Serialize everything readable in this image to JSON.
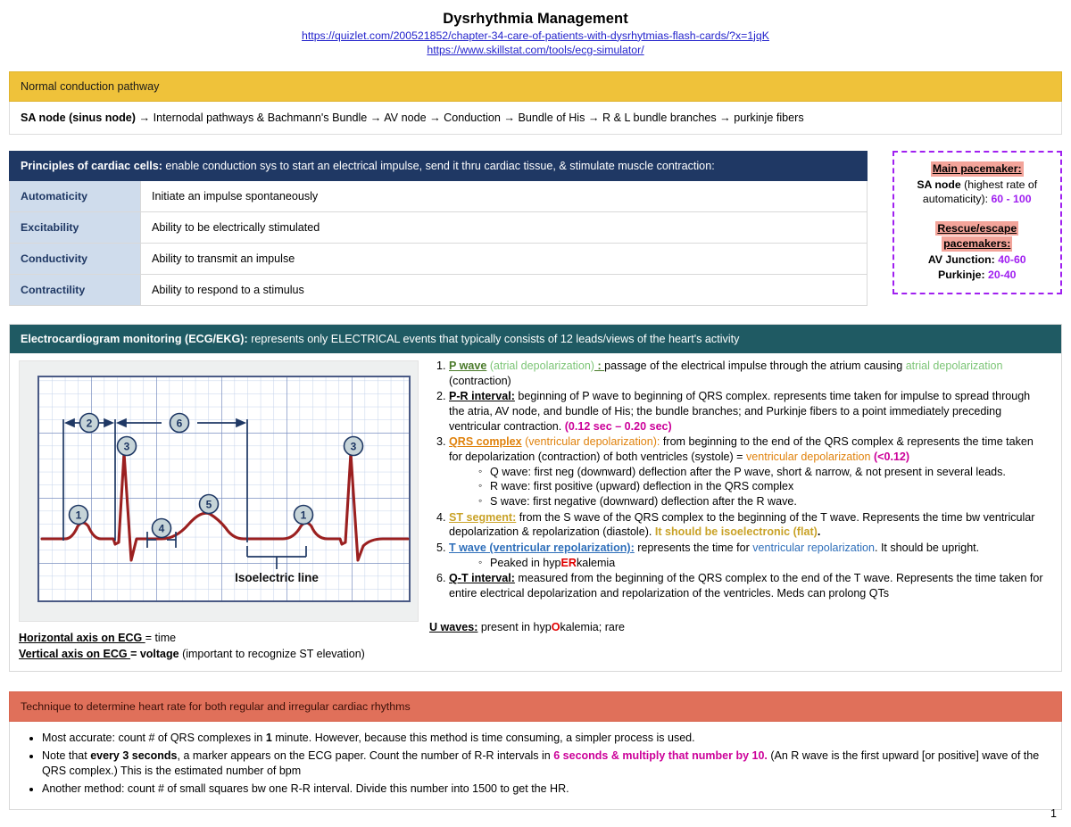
{
  "document": {
    "title": "Dysrhythmia Management",
    "links": [
      "https://quizlet.com/200521852/chapter-34-care-of-patients-with-dysrhytmias-flash-cards/?x=1jqK",
      "https://www.skillstat.com/tools/ecg-simulator/"
    ],
    "page_number": "1"
  },
  "conduction": {
    "header": "Normal conduction pathway",
    "pathway_start": "SA node (sinus node)",
    "pathway_rest": " → Internodal pathways & Bachmann's Bundle → AV node → Conduction → Bundle of His → R & L bundle branches → purkinje fibers"
  },
  "principles": {
    "header_bold": "Principles of cardiac cells:",
    "header_rest": " enable conduction sys to start an electrical impulse, send it thru cardiac tissue, & stimulate muscle contraction:",
    "rows": [
      {
        "term": "Automaticity",
        "definition": "Initiate an impulse spontaneously"
      },
      {
        "term": "Excitability",
        "definition": "Ability to be electrically stimulated"
      },
      {
        "term": "Conductivity",
        "definition": "Ability to transmit an impulse"
      },
      {
        "term": "Contractility",
        "definition": "Ability to respond to a stimulus"
      }
    ]
  },
  "pacemakers": {
    "main_heading": "Main pacemaker:",
    "main_bold": "SA node",
    "main_text": " (highest rate of automaticity): ",
    "main_rate": "60 - 100",
    "rescue_heading_line1": "Rescue/escape",
    "rescue_heading_line2": "pacemakers:",
    "rescue": [
      {
        "label": "AV Junction:",
        "rate": "40-60"
      },
      {
        "label": "Purkinje:",
        "rate": "20-40"
      }
    ]
  },
  "ecg": {
    "header_bold": "Electrocardiogram monitoring (ECG/EKG):",
    "header_rest": " represents only ELECTRICAL events that typically consists of 12 leads/views of the heart's activity",
    "figure": {
      "isoelectric_label": "Isoelectric line",
      "callouts": [
        "1",
        "2",
        "3",
        "4",
        "5",
        "6",
        "1",
        "3"
      ]
    },
    "axes": {
      "horizontal_label": "Horizontal axis on ECG ",
      "horizontal_value": "= time",
      "vertical_label": "Vertical axis on ECG ",
      "vertical_value_bold": "= voltage",
      "vertical_value_rest": " (important to recognize ST elevation)"
    },
    "items": {
      "i1": {
        "term": "P wave",
        "paren": " (atrial depolarization)",
        "colon": " : ",
        "text1": "passage of the electrical impulse through the atrium causing ",
        "hl": "atrial depolarization",
        "text2": " (contraction)"
      },
      "i2": {
        "term": "P-R interval:",
        "text": " beginning of P wave to beginning of QRS complex. represents time taken for impulse to spread through the atria, AV node, and bundle of His; the bundle branches; and Purkinje fibers to a point immediately preceding ventricular contraction. ",
        "value": "(0.12 sec – 0.20 sec)"
      },
      "i3": {
        "term": "QRS complex",
        "paren": " (ventricular depolarization):",
        "text1": " from beginning to the end of the QRS complex & represents the time taken for depolarization (contraction) of both ventricles (systole) = ",
        "hl": "ventricular depolarization",
        "value": " (<0.12)",
        "subs": [
          "Q wave: first neg (downward) deflection after the P wave, short & narrow, & not present in several leads.",
          "R wave: first positive (upward) deflection in the QRS complex",
          "S wave: first negative (downward) deflection after the R wave."
        ]
      },
      "i4": {
        "term": "ST segment:",
        "text": " from the S wave of the QRS complex to the beginning of the T wave. Represents the time bw ventricular depolarization & repolarization (diastole). ",
        "hl": "It should be isoelectronic (flat)",
        "period": "."
      },
      "i5": {
        "term": "T wave (ventricular repolarization):",
        "text1": " represents the time for ",
        "hl": "ventricular repolarization",
        "text2": ". It should be upright.",
        "subs_pre": "Peaked in hyp",
        "subs_hl": "ER",
        "subs_post": "kalemia"
      },
      "i6": {
        "term": "Q-T interval:",
        "text": " measured from the beginning of the QRS complex to the end of the T wave. Represents the time taken for entire electrical depolarization and repolarization of the ventricles. Meds can prolong QTs"
      }
    },
    "u_waves": {
      "term": "U waves:",
      "text1": " present in hyp",
      "hl": "O",
      "text2": "kalemia; rare"
    }
  },
  "technique": {
    "header": "Technique to determine heart rate for both regular and irregular cardiac rhythms",
    "bullets": {
      "b1_pre": "Most accurate: count # of QRS complexes in ",
      "b1_bold": "1",
      "b1_post": " minute. However, because this method is time consuming, a simpler process is used.",
      "b2_pre": "Note that ",
      "b2_bold": "every 3 seconds",
      "b2_mid": ", a marker appears on the ECG paper. Count the number of R-R intervals in ",
      "b2_hl": "6 seconds & multiply that number by 10.",
      "b2_post": " (An R wave is the first upward [or positive] wave of the QRS complex.) This is the estimated number of bpm",
      "b3": "Another method: count # of small squares bw one R-R interval. Divide this number into 1500 to get the HR."
    }
  },
  "colors": {
    "yellow_bar": "#efc23a",
    "navy_bar": "#1f3864",
    "teal_bar": "#1f5a63",
    "salmon_bar": "#e0705a",
    "purple": "#a020f0",
    "pink_highlight": "#f3a49a",
    "ecg_trace": "#9b2020"
  }
}
